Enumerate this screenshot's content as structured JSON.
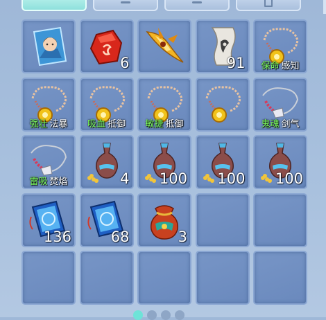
{
  "colors": {
    "tag_accent": "#7dff5c",
    "slot_bg": "#6a89bd",
    "active_tab": "#8fe0dc"
  },
  "tabs": [
    {
      "icon": "tab-selected-icon",
      "active": true
    },
    {
      "icon": "tab-dash-icon",
      "active": false
    },
    {
      "icon": "tab-dash-icon",
      "active": false
    },
    {
      "icon": "tab-box-icon",
      "active": false
    }
  ],
  "inventory": {
    "slots": [
      {
        "icon": "portrait-card-icon",
        "count": ""
      },
      {
        "icon": "red-gem-icon",
        "count": "6"
      },
      {
        "icon": "golden-blade-icon",
        "count": ""
      },
      {
        "icon": "scroll-icon",
        "count": "91"
      },
      {
        "icon": "gold-necklace-icon",
        "tag1": "保命",
        "tag2": "感知"
      },
      {
        "icon": "gold-necklace-icon",
        "tag1": "强壮",
        "tag2": "法暴"
      },
      {
        "icon": "gold-necklace-icon",
        "tag1": "吸血",
        "tag2": "抵御"
      },
      {
        "icon": "gold-necklace-icon",
        "tag1": "敏捷",
        "tag2": "抵御"
      },
      {
        "icon": "gold-necklace-icon",
        "tag1": "",
        "tag2": ""
      },
      {
        "icon": "bead-necklace-icon",
        "tag1": "鬼魂",
        "tag2": "剑气"
      },
      {
        "icon": "bead-necklace-icon",
        "tag1": "雷吸",
        "tag2": "焚焰"
      },
      {
        "icon": "vase-icon",
        "count": "4"
      },
      {
        "icon": "vase-icon",
        "count": "100"
      },
      {
        "icon": "vase-icon",
        "count": "100"
      },
      {
        "icon": "vase-icon",
        "count": "100"
      },
      {
        "icon": "blue-book-icon",
        "count": "136"
      },
      {
        "icon": "blue-book-icon",
        "count": "68"
      },
      {
        "icon": "pouch-icon",
        "count": "3"
      }
    ]
  },
  "pager": {
    "pages": 4,
    "current": 0
  }
}
